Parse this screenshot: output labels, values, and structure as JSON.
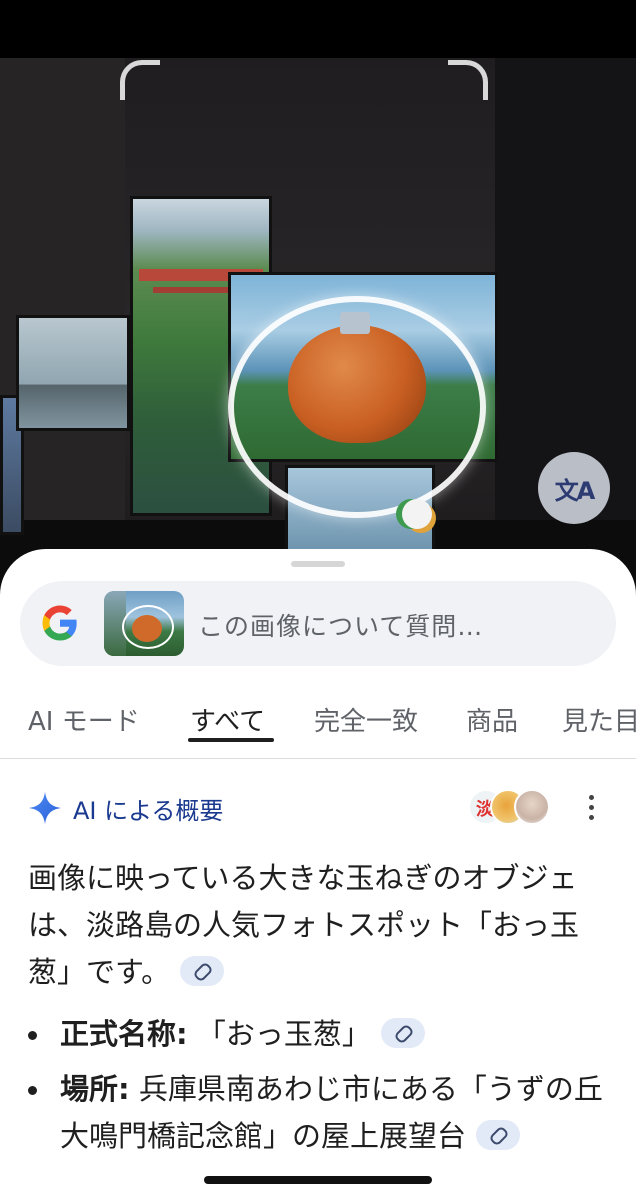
{
  "icons": {
    "translate": "translate-icon",
    "google": "google-logo-icon",
    "sparkle": "ai-sparkle-icon",
    "link": "link-icon",
    "more": "more-vert-icon"
  },
  "search": {
    "placeholder": "この画像について質問…"
  },
  "tabs": [
    {
      "label": "AI モード"
    },
    {
      "label": "すべて"
    },
    {
      "label": "完全一致"
    },
    {
      "label": "商品"
    },
    {
      "label": "見た目"
    }
  ],
  "ai_overview": {
    "title": "AI による概要",
    "source_badge_text": "淡",
    "summary": "画像に映っている大きな玉ねぎのオブジェは、淡路島の人気フォトスポット「おっ玉葱」です。",
    "bullets": [
      {
        "label": "正式名称:",
        "text": " 「おっ玉葱」"
      },
      {
        "label": "場所:",
        "text": " 兵庫県南あわじ市にある「うずの丘 大鳴門橋記念館」の屋上展望台"
      }
    ]
  },
  "colors": {
    "accent": "#1a3a8f",
    "sheet_bg": "#ffffff",
    "search_bg": "#f0f2f5"
  }
}
